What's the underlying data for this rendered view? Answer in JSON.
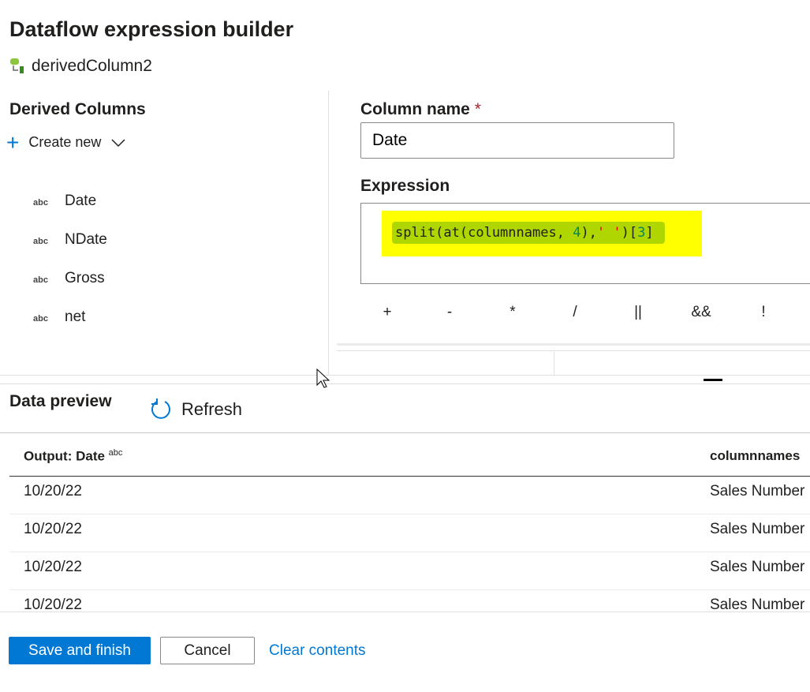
{
  "title": "Dataflow expression builder",
  "node_name": "derivedColumn2",
  "derived": {
    "heading": "Derived Columns",
    "create_new": "Create new",
    "type_label": "abc",
    "items": [
      "Date",
      "NDate",
      "Gross",
      "net"
    ]
  },
  "column_name": {
    "label": "Column name",
    "required": "*",
    "value": "Date"
  },
  "expression": {
    "label": "Expression",
    "code": {
      "fn": "split(at(columnnames,",
      "num1": "4",
      "mid": "),",
      "str": "' '",
      "close": ")[",
      "idx": "3",
      "end": "]"
    }
  },
  "operators": [
    "+",
    "-",
    "*",
    "/",
    "||",
    "&&",
    "!"
  ],
  "preview": {
    "heading": "Data preview",
    "refresh": "Refresh",
    "col1": "Output: Date",
    "col1_type": "abc",
    "col2": "columnnames",
    "rows": [
      [
        "10/20/22",
        "Sales Number"
      ],
      [
        "10/20/22",
        "Sales Number"
      ],
      [
        "10/20/22",
        "Sales Number"
      ],
      [
        "10/20/22",
        "Sales Number"
      ]
    ]
  },
  "footer": {
    "save": "Save and finish",
    "cancel": "Cancel",
    "clear": "Clear contents"
  },
  "colors": {
    "accent": "#0078d4",
    "highlight": "#ffff00",
    "selection": "#b0d600"
  }
}
